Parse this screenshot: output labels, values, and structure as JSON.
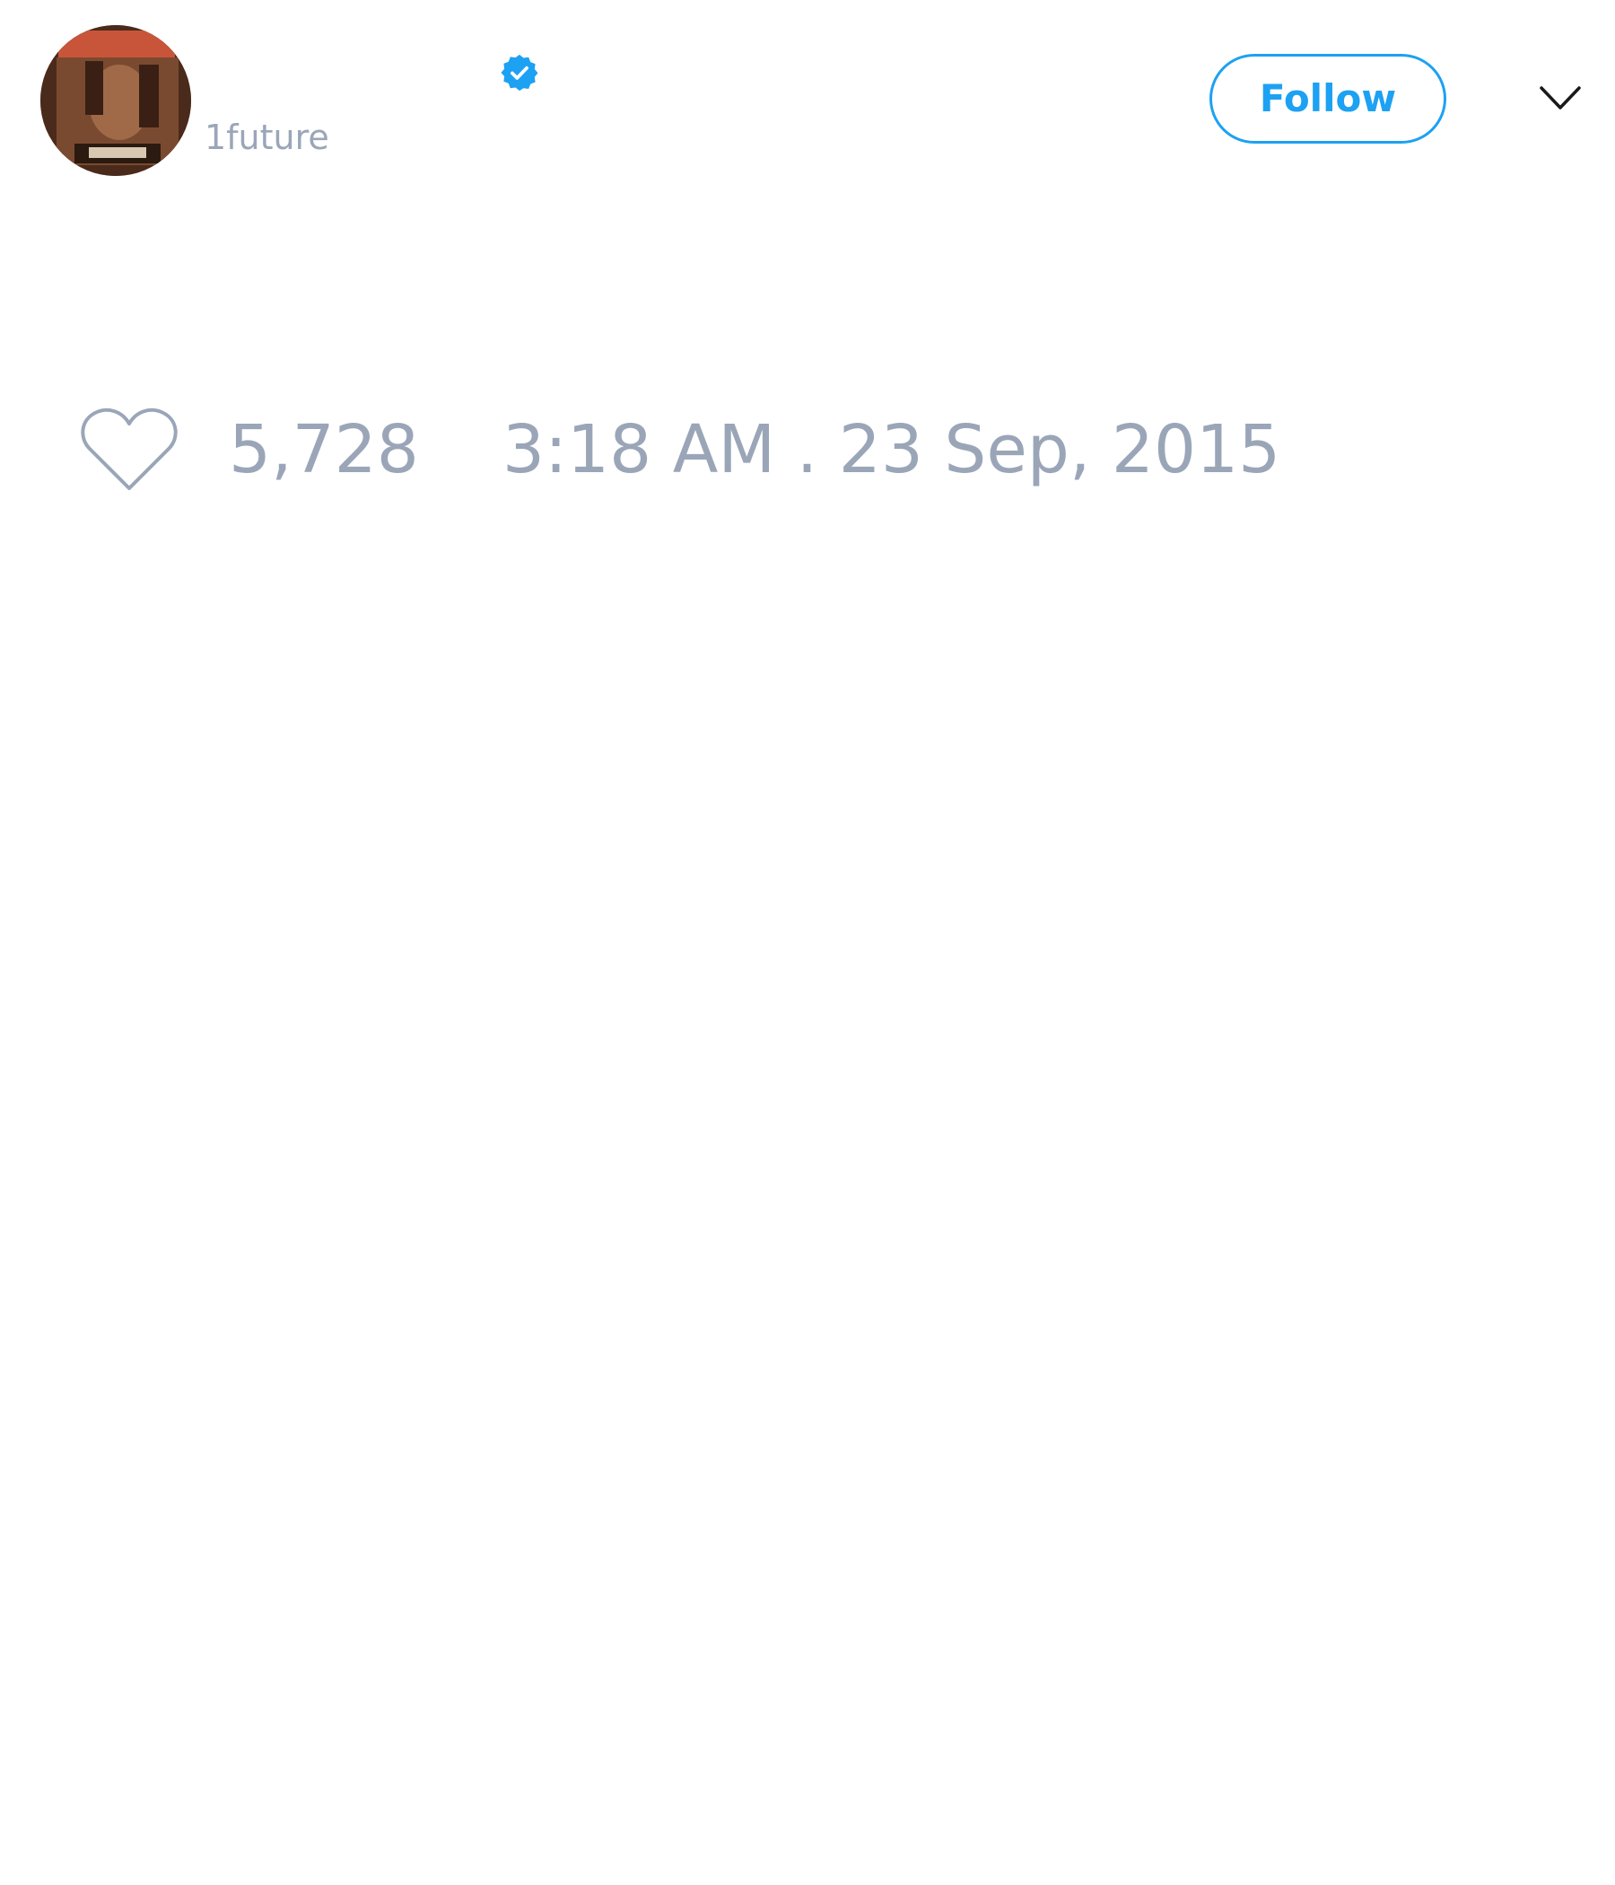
{
  "author": {
    "display_name": "",
    "handle": "1future",
    "verified": true,
    "avatar_icon": "magazine-cover-avatar"
  },
  "actions": {
    "follow_label": "Follow",
    "menu_icon": "chevron-down-icon"
  },
  "stats": {
    "like_icon": "heart-icon",
    "like_count": "5,728",
    "timestamp": "3:18 AM . 23 Sep, 2015"
  },
  "colors": {
    "accent": "#1da1f2",
    "muted_text": "#9aa6b8",
    "background": "#ffffff"
  }
}
